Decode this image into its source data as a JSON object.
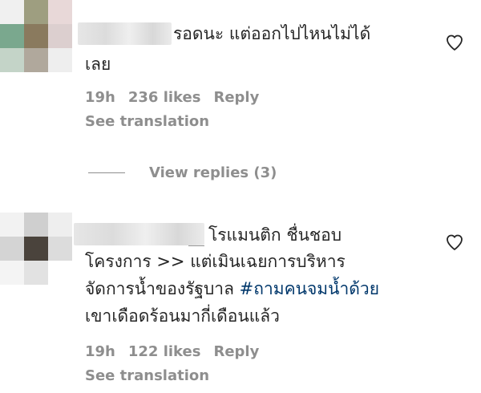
{
  "comments": [
    {
      "text_line1": "รอดนะ แต่ออกไปไหนไม่ได้",
      "text_line2": "เลย",
      "time": "19h",
      "likes": "236 likes",
      "reply": "Reply",
      "see_translation": "See translation",
      "like_icon": "heart-outline-icon"
    },
    {
      "text_line1": "โรแมนติก ชื่นชอบ",
      "text_line2": "โครงการ >> แต่เมินเฉยการบริหาร",
      "text_line3_plain": "จัดการน้ำของรัฐบาล ",
      "text_line3_hashtag": "#ถามคนจมน้ำด้วย",
      "text_line4": "เขาเดือดร้อนมากี่เดือนแล้ว",
      "time": "19h",
      "likes": "122 likes",
      "reply": "Reply",
      "see_translation": "See translation",
      "like_icon": "heart-outline-icon"
    }
  ],
  "view_replies": "View replies (3)",
  "colors": {
    "text": "#262626",
    "meta": "#8e8e8e",
    "hashtag": "#00376b"
  }
}
